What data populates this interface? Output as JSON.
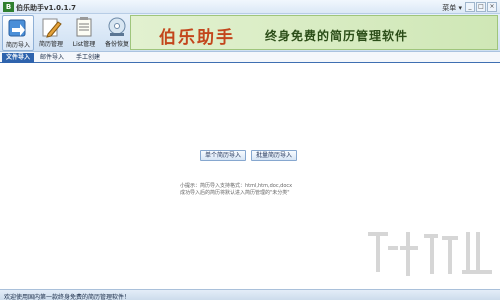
{
  "window": {
    "title": "伯乐助手v1.0.1.7",
    "menu_label": "菜单 ▾",
    "logo_char": "B",
    "controls": {
      "minimize": "_",
      "maximize": "□",
      "close": "×"
    }
  },
  "toolbar": {
    "items": [
      {
        "label": "简历导入",
        "icon": "import-arrow-icon",
        "active": true
      },
      {
        "label": "简历管理",
        "icon": "pencil-icon",
        "active": false
      },
      {
        "label": "List管理",
        "icon": "notepad-icon",
        "active": false
      },
      {
        "label": "备份恢复",
        "icon": "disc-icon",
        "active": false
      }
    ]
  },
  "banner": {
    "logo": "伯乐助手",
    "slogan": "终身免费的简历管理软件"
  },
  "tabs": [
    {
      "label": "文件导入",
      "active": true
    },
    {
      "label": "邮件导入",
      "active": false
    },
    {
      "label": "手工创建",
      "active": false
    }
  ],
  "content": {
    "single_import_button": "单个简历导入",
    "batch_import_button": "批量简历导入",
    "tip_label": "小提示：",
    "tip_line1": "简历导入支持格式：html,htm,doc,docx",
    "tip_line2": "成功导入后的简历将默认进入简历管理的\"未分类\""
  },
  "status": {
    "text": "欢迎使用国内第一款终身免费的简历管理软件！"
  },
  "colors": {
    "tab_active": "#2e63ad",
    "banner_logo": "#c3461c",
    "banner_bg": "#cfe7b6"
  }
}
